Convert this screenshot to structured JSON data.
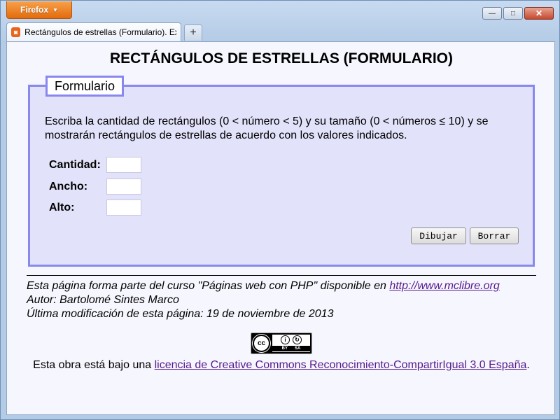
{
  "browser": {
    "menu_button": "Firefox",
    "controls": {
      "minimize": "—",
      "maximize": "□",
      "close": "✕"
    },
    "tab": {
      "title": "Rectángulos de estrellas (Formulario). Ex...",
      "favicon": "firefox-page-icon"
    },
    "new_tab": "+"
  },
  "page": {
    "title": "RECTÁNGULOS DE ESTRELLAS (FORMULARIO)",
    "fieldset_legend": "Formulario",
    "instructions": "Escriba la cantidad de rectángulos (0 < número < 5) y su tamaño (0 < números ≤ 10) y se mostrarán rectángulos de estrellas de acuerdo con los valores indicados.",
    "fields": [
      {
        "label": "Cantidad:",
        "value": ""
      },
      {
        "label": "Ancho:",
        "value": ""
      },
      {
        "label": "Alto:",
        "value": ""
      }
    ],
    "buttons": {
      "draw": "Dibujar",
      "clear": "Borrar"
    }
  },
  "footer": {
    "course_text": "Esta página forma parte del curso \"Páginas web con PHP\" disponible en ",
    "course_link": "http://www.mclibre.org",
    "author": "Autor: Bartolomé Sintes Marco",
    "last_modified": "Última modificación de esta página: 19 de noviembre de 2013",
    "license_prefix": "Esta obra está bajo una ",
    "license_link": "licencia de Creative Commons Reconocimiento-CompartirIgual 3.0 España",
    "license_suffix": ".",
    "cc_badge": {
      "main": "cc",
      "by": "BY",
      "sa": "SA"
    }
  },
  "colors": {
    "fieldset_border": "#8888ee",
    "fieldset_bg": "#e2e2fa",
    "link": "#551a8b",
    "firefox_orange": "#e36b0d"
  }
}
